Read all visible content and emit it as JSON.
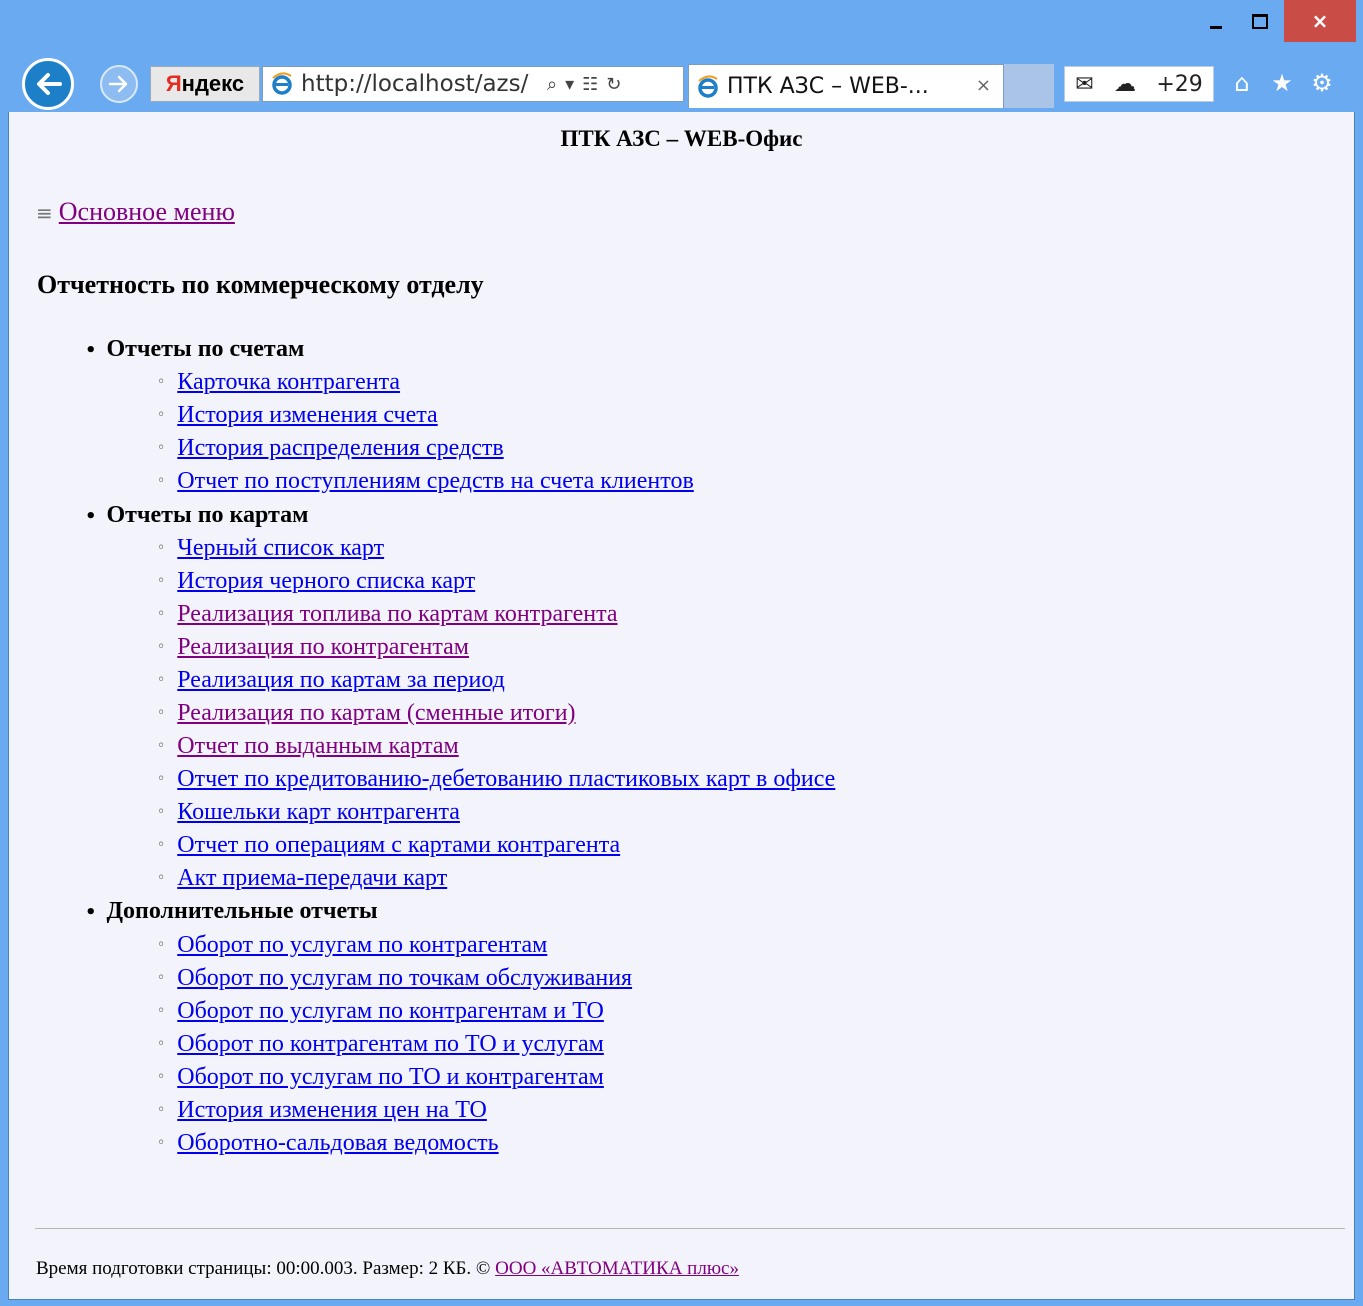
{
  "window": {
    "minimize_label": "",
    "close_label": "×"
  },
  "navigation": {
    "yandex_label_y": "Я",
    "yandex_label_rest": "ндекс",
    "address_url": "http://localhost/azs/",
    "tab_title": "ПТК АЗС – WEB-...",
    "tab_close": "×",
    "mail_temp": "+29",
    "icons": [
      "back-arrow-icon",
      "forward-arrow-icon",
      "ie-icon",
      "search-icon",
      "refresh-icon",
      "mail-icon",
      "cloud-icon",
      "home-icon",
      "star-icon",
      "gear-icon"
    ]
  },
  "page": {
    "title": "ПТК АЗС – WEB-Офис",
    "main_menu": "Основное меню",
    "section_title": "Отчетность по коммерческому отделу",
    "groups": [
      {
        "label": "Отчеты по счетам",
        "items": [
          {
            "label": "Карточка контрагента",
            "visited": false
          },
          {
            "label": "История изменения счета",
            "visited": false
          },
          {
            "label": "История распределения средств",
            "visited": false
          },
          {
            "label": "Отчет по поступлениям средств на счета клиентов",
            "visited": false
          }
        ]
      },
      {
        "label": "Отчеты по картам",
        "items": [
          {
            "label": "Черный список карт",
            "visited": false
          },
          {
            "label": "История черного списка карт",
            "visited": false
          },
          {
            "label": "Реализация топлива по картам контрагента",
            "visited": true
          },
          {
            "label": "Реализация по контрагентам",
            "visited": true
          },
          {
            "label": "Реализация по картам за период",
            "visited": false
          },
          {
            "label": "Реализация по картам (сменные итоги)",
            "visited": true
          },
          {
            "label": "Отчет по выданным картам",
            "visited": true
          },
          {
            "label": "Отчет по кредитованию-дебетованию пластиковых карт в офисе",
            "visited": false
          },
          {
            "label": "Кошельки карт контрагента",
            "visited": false
          },
          {
            "label": "Отчет по операциям с картами контрагента",
            "visited": false
          },
          {
            "label": "Акт приема-передачи карт",
            "visited": false
          }
        ]
      },
      {
        "label": "Дополнительные отчеты",
        "items": [
          {
            "label": "Оборот по услугам по контрагентам",
            "visited": false
          },
          {
            "label": "Оборот по услугам по точкам обслуживания",
            "visited": false
          },
          {
            "label": "Оборот по услугам по контрагентам и ТО",
            "visited": false
          },
          {
            "label": "Оборот по контрагентам по ТО и услугам",
            "visited": false
          },
          {
            "label": "Оборот по услугам по ТО и контрагентам",
            "visited": false
          },
          {
            "label": "История изменения цен на ТО",
            "visited": false
          },
          {
            "label": "Оборотно-сальдовая ведомость",
            "visited": false
          }
        ]
      }
    ],
    "footer_text": "Время подготовки страницы: 00:00.003. Размер: 2 КБ. © ",
    "footer_link": "ООО «АВТОМАТИКА плюс»"
  },
  "colors": {
    "frame": "#6aaaf0",
    "link": "#0000ee",
    "visited_link": "#800080",
    "close_button": "#c94c47"
  }
}
